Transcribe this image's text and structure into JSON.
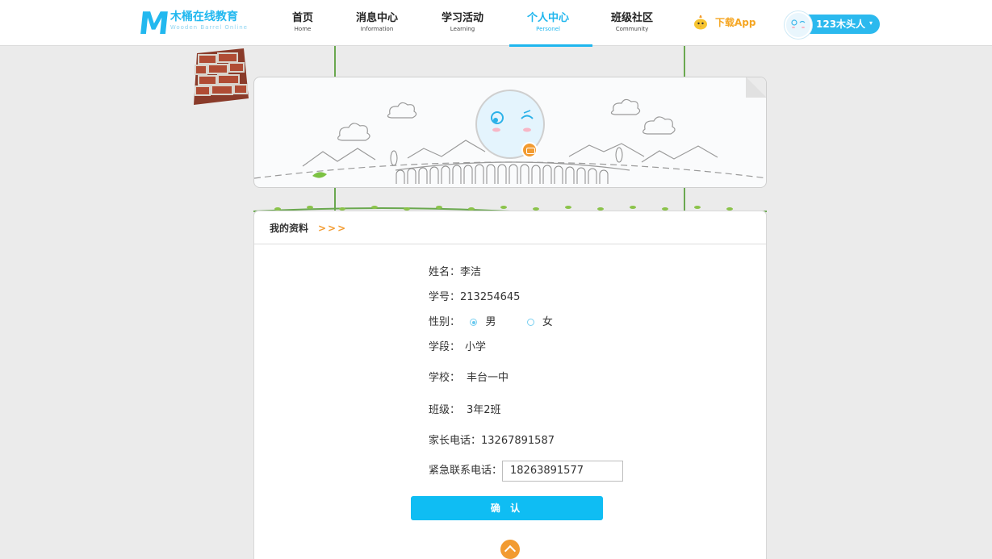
{
  "brand": {
    "name_cn": "木桶在线教育",
    "name_en": "Wooden Barrel Online"
  },
  "nav": [
    {
      "cn": "首页",
      "en": "Home"
    },
    {
      "cn": "消息中心",
      "en": "Information"
    },
    {
      "cn": "学习活动",
      "en": "Learning"
    },
    {
      "cn": "个人中心",
      "en": "Personel"
    },
    {
      "cn": "班级社区",
      "en": "Community"
    }
  ],
  "active_nav": "个人中心",
  "download_label": "下载App",
  "user": {
    "name": "123木头人",
    "caret": "▾"
  },
  "section": {
    "title": "我的资料",
    "arrows": ">>>"
  },
  "profile": {
    "name_label": "姓名：",
    "name": "李洁",
    "id_label": "学号：",
    "id": "213254645",
    "gender_label": "性别：",
    "male": "男",
    "female": "女",
    "gender_selected": "男",
    "stage_label": "学段：",
    "stage": "小学",
    "school_label": "学校：",
    "school": "丰台一中",
    "class_label": "班级：",
    "class": "3年2班",
    "parent_phone_label": "家长电话：",
    "parent_phone": "13267891587",
    "emergency_label": "紧急联系电话：",
    "emergency_phone": "18263891577"
  },
  "confirm_label": "确 认",
  "colors": {
    "accent": "#1fb6ee",
    "orange": "#f29b31",
    "button": "#0fbdf3"
  },
  "icons": [
    "bird-icon",
    "caret-down-icon",
    "camera-icon",
    "arrow-up-icon",
    "radio-icon"
  ]
}
